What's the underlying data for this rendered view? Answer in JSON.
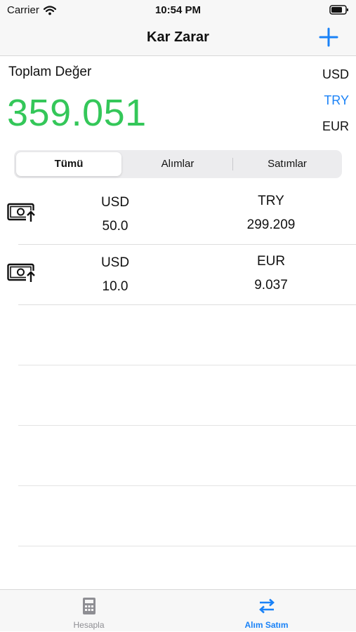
{
  "status": {
    "carrier": "Carrier",
    "time": "10:54 PM"
  },
  "nav": {
    "title": "Kar Zarar"
  },
  "summary": {
    "label": "Toplam Değer",
    "total": "359.051",
    "total_color": "#34c759"
  },
  "currencies": [
    "USD",
    "TRY",
    "EUR"
  ],
  "selected_currency": "TRY",
  "accent_color": "#1a82f7",
  "segments": [
    "Tümü",
    "Alımlar",
    "Satımlar"
  ],
  "selected_segment": "Tümü",
  "transactions": [
    {
      "icon": "money-buy-icon",
      "from_currency": "USD",
      "amount": "50.0",
      "to_currency": "TRY",
      "converted": "299.209"
    },
    {
      "icon": "money-buy-icon",
      "from_currency": "USD",
      "amount": "10.0",
      "to_currency": "EUR",
      "converted": "9.037"
    }
  ],
  "tabs": [
    {
      "label": "Hesapla",
      "icon": "calculator-icon"
    },
    {
      "label": "Alım Satım",
      "icon": "swap-arrows-icon"
    }
  ],
  "active_tab": "Alım Satım"
}
